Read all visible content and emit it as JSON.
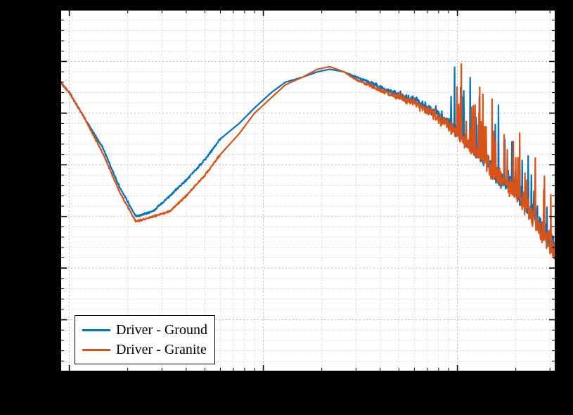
{
  "chart_data": {
    "type": "line",
    "xaxis_scale": "log",
    "xlim": [
      9,
      3200
    ],
    "ylim": [
      -70,
      0
    ],
    "xlabel": "",
    "ylabel": "",
    "grid": true,
    "legend_position": "lower-left",
    "x_major_ticks": [
      10,
      100,
      1000
    ],
    "y_major_ticks": [
      -60,
      -50,
      -40,
      -30,
      -20,
      -10,
      0
    ],
    "series": [
      {
        "name": "Driver - Ground",
        "color": "#0072BD",
        "x": [
          9,
          10,
          12,
          15,
          18,
          22,
          27,
          33,
          40,
          50,
          60,
          75,
          90,
          110,
          130,
          160,
          190,
          220,
          260,
          300,
          350,
          400,
          460,
          520,
          600,
          700,
          800,
          900,
          1000,
          1100,
          1200,
          1300,
          1400,
          1500,
          1600,
          1700,
          1800,
          1900,
          2000,
          2100,
          2200,
          2300,
          2400,
          2500,
          2600,
          2700,
          2800,
          2900,
          3000,
          3100,
          3200
        ],
        "y": [
          -14,
          -16,
          -21,
          -27,
          -34,
          -40,
          -39,
          -36,
          -33,
          -29,
          -25,
          -22,
          -19,
          -16,
          -14,
          -13,
          -12,
          -11.5,
          -12,
          -13,
          -14,
          -15,
          -16,
          -16.5,
          -17.5,
          -19,
          -20,
          -22,
          -23.5,
          -25,
          -26.5,
          -28,
          -29,
          -30.5,
          -32,
          -33,
          -33.5,
          -34,
          -35,
          -36,
          -37,
          -38,
          -39,
          -40,
          -41,
          -42,
          -43,
          -44,
          -45,
          -46,
          -47
        ]
      },
      {
        "name": "Driver - Granite",
        "color": "#D95319",
        "x": [
          9,
          10,
          12,
          15,
          18,
          22,
          27,
          33,
          40,
          50,
          60,
          75,
          90,
          110,
          130,
          160,
          190,
          220,
          260,
          300,
          350,
          400,
          460,
          520,
          600,
          700,
          800,
          900,
          1000,
          1100,
          1200,
          1300,
          1400,
          1500,
          1600,
          1700,
          1800,
          1900,
          2000,
          2100,
          2200,
          2300,
          2400,
          2500,
          2600,
          2700,
          2800,
          2900,
          3000,
          3100,
          3200
        ],
        "y": [
          -14,
          -16,
          -21,
          -28,
          -35,
          -41,
          -40,
          -39,
          -36,
          -32,
          -28,
          -24,
          -20,
          -17,
          -14.5,
          -13,
          -11.5,
          -11,
          -12,
          -13.5,
          -14.5,
          -15.5,
          -16.5,
          -17,
          -18,
          -19.5,
          -21,
          -22.5,
          -24,
          -25.5,
          -27,
          -28,
          -29.5,
          -31,
          -32,
          -33,
          -33.5,
          -34.5,
          -35.5,
          -36.5,
          -37.5,
          -38.5,
          -39.5,
          -40.5,
          -41.5,
          -42.5,
          -43.5,
          -44.5,
          -45.5,
          -46.5,
          -47.5
        ]
      }
    ]
  },
  "legend": {
    "items": [
      {
        "label": "Driver - Ground",
        "color": "#0072BD"
      },
      {
        "label": "Driver - Granite",
        "color": "#D95319"
      }
    ]
  }
}
